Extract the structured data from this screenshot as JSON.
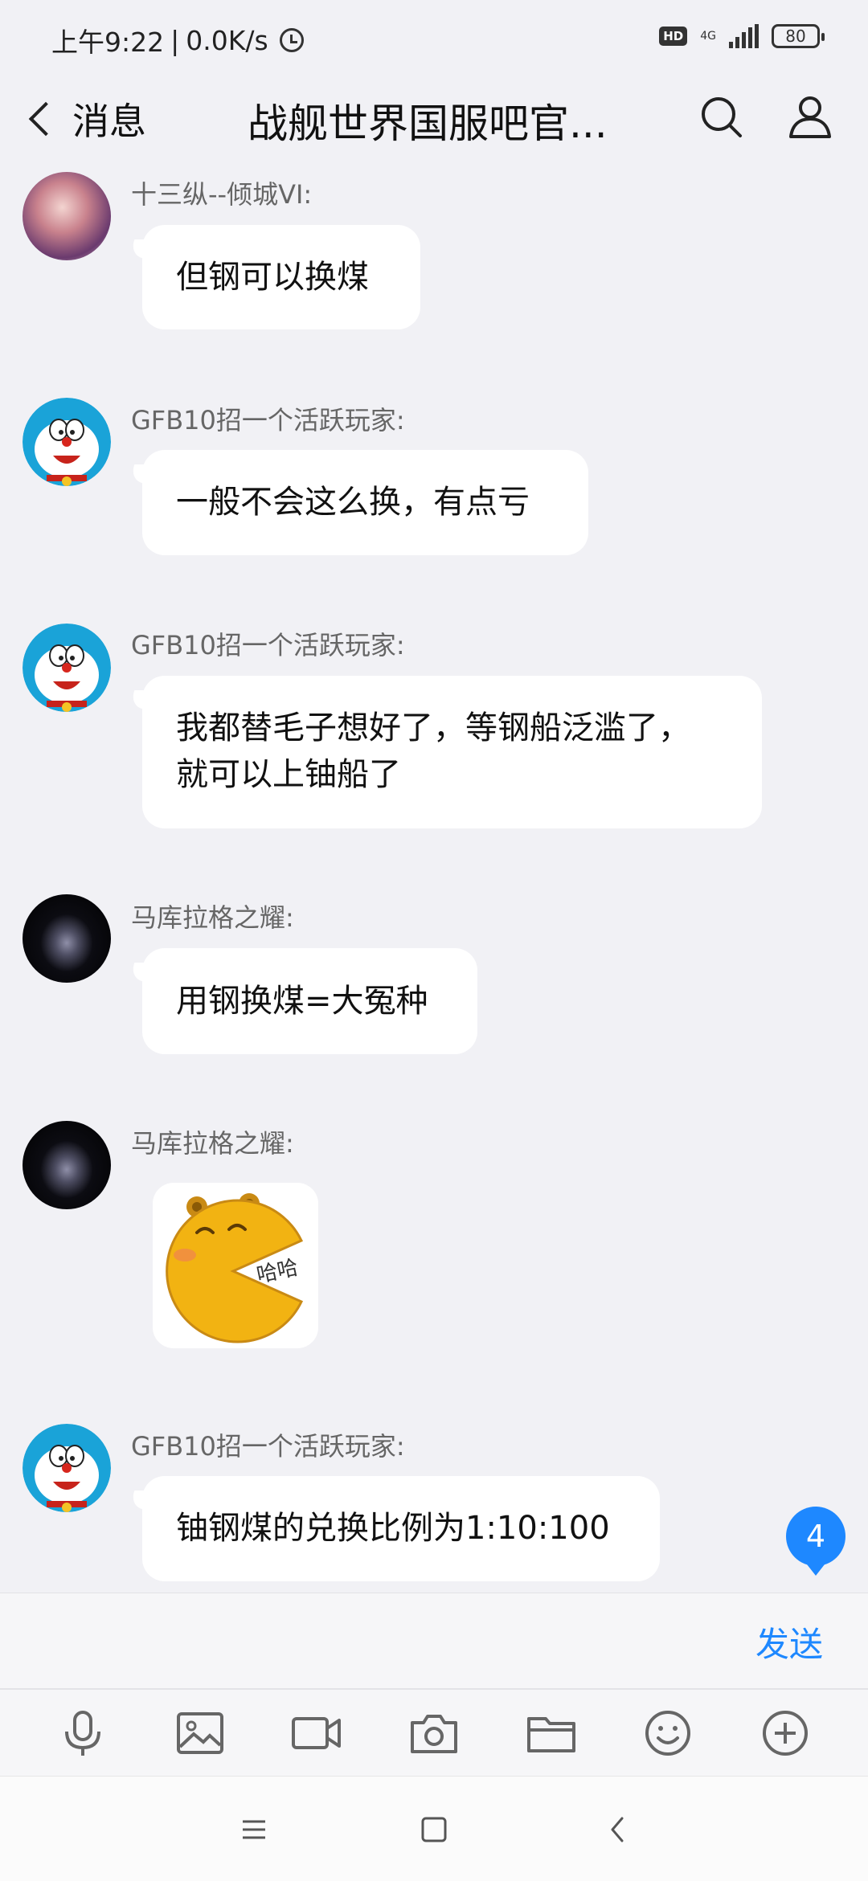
{
  "status_bar": {
    "time": "上午9:22",
    "separator": "|",
    "net_speed": "0.0K/s",
    "hd": "HD",
    "network": "4G",
    "battery": "80"
  },
  "header": {
    "back_label": "消息",
    "title": "战舰世界国服吧官...",
    "search_icon": "search-icon",
    "profile_icon": "person-icon"
  },
  "messages": [
    {
      "sender": "十三纵--倾城VI:",
      "text": "但钢可以换煤"
    },
    {
      "sender": "GFB10招一个活跃玩家:",
      "text": "一般不会这么换，有点亏"
    },
    {
      "sender": "GFB10招一个活跃玩家:",
      "text_lines": [
        "我都替毛子想好了，等钢船泛滥了，",
        "就可以上铀船了"
      ]
    },
    {
      "sender": "马库拉格之耀:",
      "text": "用钢换煤=大冤种"
    },
    {
      "sender": "马库拉格之耀:",
      "sticker_text": "哈哈"
    },
    {
      "sender": "GFB10招一个活跃玩家:",
      "text": "铀钢煤的兑换比例为1:10:100"
    }
  ],
  "unread_count": "4",
  "input": {
    "send_label": "发送",
    "tools": [
      "microphone-icon",
      "image-icon",
      "video-icon",
      "camera-icon",
      "folder-icon",
      "emoji-icon",
      "plus-icon"
    ]
  },
  "colors": {
    "accent": "#1e88ff",
    "background": "#f1f1f5",
    "bubble": "#ffffff"
  }
}
